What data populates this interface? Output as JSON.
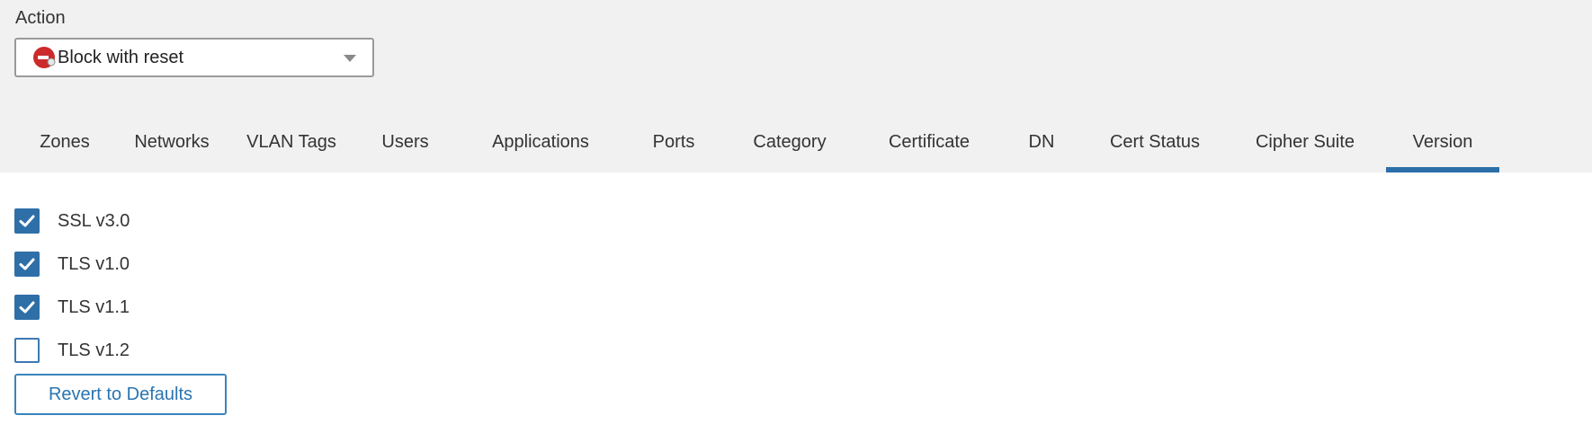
{
  "action": {
    "label": "Action",
    "selected_value": "Block with reset",
    "icon": "block-with-reset-icon",
    "icon_color": "#cc2b2b"
  },
  "tabs": [
    {
      "label": "Zones",
      "active": false
    },
    {
      "label": "Networks",
      "active": false
    },
    {
      "label": "VLAN Tags",
      "active": false
    },
    {
      "label": "Users",
      "active": false
    },
    {
      "label": "Applications",
      "active": false
    },
    {
      "label": "Ports",
      "active": false
    },
    {
      "label": "Category",
      "active": false
    },
    {
      "label": "Certificate",
      "active": false
    },
    {
      "label": "DN",
      "active": false
    },
    {
      "label": "Cert Status",
      "active": false
    },
    {
      "label": "Cipher Suite",
      "active": false
    },
    {
      "label": "Version",
      "active": true
    }
  ],
  "versions": [
    {
      "label": "SSL v3.0",
      "checked": true
    },
    {
      "label": "TLS v1.0",
      "checked": true
    },
    {
      "label": "TLS v1.1",
      "checked": true
    },
    {
      "label": "TLS v1.2",
      "checked": false
    }
  ],
  "revert_button": {
    "label": "Revert to Defaults"
  },
  "colors": {
    "accent": "#2a6fa8",
    "checkbox": "#2f6fa8",
    "top_background": "#f1f1f1"
  }
}
